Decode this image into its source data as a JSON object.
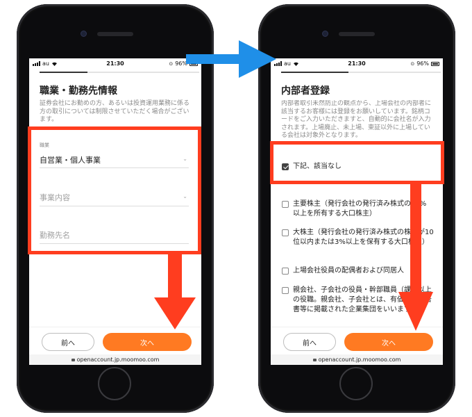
{
  "colors": {
    "accent_orange": "#ff7a22",
    "highlight_red": "#ff3d1f",
    "arrow_blue": "#1f8fe8"
  },
  "left_screen": {
    "status": {
      "carrier": "au",
      "time": "21:30",
      "battery": "96%"
    },
    "progress": 0.3,
    "title": "職業・勤務先情報",
    "description": "証券会社にお勤めの方、あるいは投資運用業務に係る方の取引については制限させていただく場合がございます。",
    "fields": {
      "occupation_label": "職業",
      "occupation_value": "自営業・個人事業",
      "business_placeholder": "事業内容",
      "employer_placeholder": "勤務先名"
    },
    "buttons": {
      "prev": "前へ",
      "next": "次へ"
    },
    "url": "openaccount.jp.moomoo.com"
  },
  "right_screen": {
    "status": {
      "carrier": "au",
      "time": "21:30",
      "battery": "96%"
    },
    "progress": 0.42,
    "title": "内部者登録",
    "description": "内部者取引未然防止の観点から、上場会社の内部者に該当するお客様には登録をお願いしています。銘柄コードをご入力いただきますと、自動的に会社名が入力されます。上場廃止、未上場、東証以外に上場している会社は対象外となります。",
    "options": [
      {
        "label": "下記、該当なし",
        "checked": true
      },
      {
        "label": "主要株主（発行会社の発行済み株式の10%以上を所有する大口株主）",
        "checked": false
      },
      {
        "label": "大株主（発行会社の発行済み株式の株数が10位以内または3%以上を保有する大口株主）",
        "checked": false
      },
      {
        "label": "上場会社役員の配偶者および同居人",
        "checked": false
      },
      {
        "label": "親会社、子会社の役員・幹部職員（課長以上の役職。親会社、子会社とは、有価証券報告書等に掲載された企業集団をいいます。）",
        "checked": false
      }
    ],
    "buttons": {
      "prev": "前へ",
      "next": "次へ"
    },
    "url": "openaccount.jp.moomoo.com"
  }
}
